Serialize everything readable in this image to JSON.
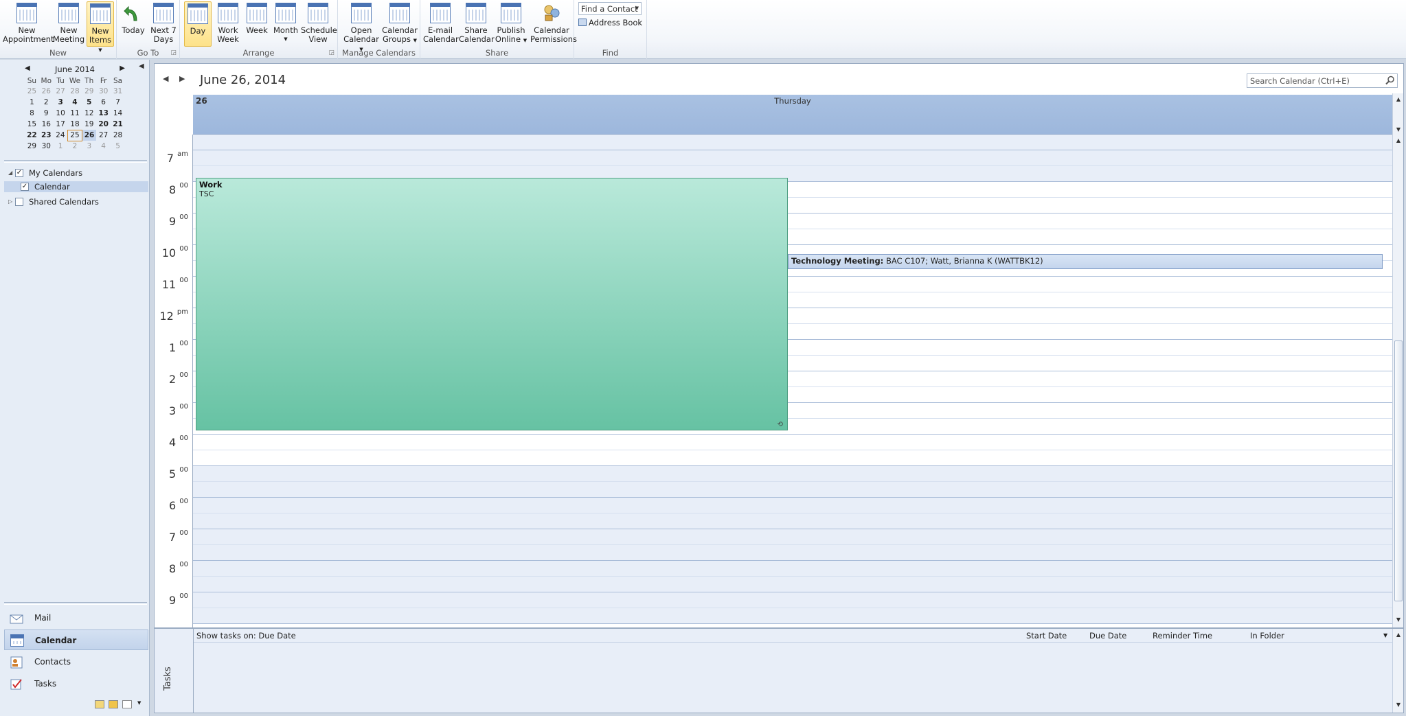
{
  "ribbon": {
    "groups": {
      "new": "New",
      "goto": "Go To",
      "arrange": "Arrange",
      "manage": "Manage Calendars",
      "share": "Share",
      "find": "Find"
    },
    "buttons": {
      "new_appointment": [
        "New",
        "Appointment"
      ],
      "new_meeting": [
        "New",
        "Meeting"
      ],
      "new_items": [
        "New",
        "Items"
      ],
      "today": [
        "Today",
        ""
      ],
      "next7": [
        "Next 7",
        "Days"
      ],
      "day": [
        "Day",
        ""
      ],
      "work_week": [
        "Work",
        "Week"
      ],
      "week": [
        "Week",
        ""
      ],
      "month": [
        "Month",
        ""
      ],
      "schedule": [
        "Schedule",
        "View"
      ],
      "open_calendar": [
        "Open",
        "Calendar"
      ],
      "calendar_groups": [
        "Calendar",
        "Groups"
      ],
      "email_calendar": [
        "E-mail",
        "Calendar"
      ],
      "share_calendar": [
        "Share",
        "Calendar"
      ],
      "publish_online": [
        "Publish",
        "Online"
      ],
      "permissions": [
        "Calendar",
        "Permissions"
      ]
    },
    "find_contact_placeholder": "Find a Contact",
    "address_book": "Address Book"
  },
  "mini_calendar": {
    "month_label": "June 2014",
    "weekdays": [
      "Su",
      "Mo",
      "Tu",
      "We",
      "Th",
      "Fr",
      "Sa"
    ],
    "weeks": [
      [
        "25",
        "26",
        "27",
        "28",
        "29",
        "30",
        "31"
      ],
      [
        "1",
        "2",
        "3",
        "4",
        "5",
        "6",
        "7"
      ],
      [
        "8",
        "9",
        "10",
        "11",
        "12",
        "13",
        "14"
      ],
      [
        "15",
        "16",
        "17",
        "18",
        "19",
        "20",
        "21"
      ],
      [
        "22",
        "23",
        "24",
        "25",
        "26",
        "27",
        "28"
      ],
      [
        "29",
        "30",
        "1",
        "2",
        "3",
        "4",
        "5"
      ]
    ]
  },
  "nav": {
    "my_calendars": "My Calendars",
    "calendar": "Calendar",
    "shared_calendars": "Shared Calendars",
    "mail": "Mail",
    "calendar_btn": "Calendar",
    "contacts": "Contacts",
    "tasks": "Tasks"
  },
  "calendar": {
    "date_title": "June 26, 2014",
    "search_placeholder": "Search Calendar (Ctrl+E)",
    "day_number": "26",
    "day_name": "Thursday",
    "hours": [
      {
        "h": "7",
        "s": "am"
      },
      {
        "h": "8",
        "s": "00"
      },
      {
        "h": "9",
        "s": "00"
      },
      {
        "h": "10",
        "s": "00"
      },
      {
        "h": "11",
        "s": "00"
      },
      {
        "h": "12",
        "s": "pm"
      },
      {
        "h": "1",
        "s": "00"
      },
      {
        "h": "2",
        "s": "00"
      },
      {
        "h": "3",
        "s": "00"
      },
      {
        "h": "4",
        "s": "00"
      },
      {
        "h": "5",
        "s": "00"
      },
      {
        "h": "6",
        "s": "00"
      },
      {
        "h": "7",
        "s": "00"
      },
      {
        "h": "8",
        "s": "00"
      },
      {
        "h": "9",
        "s": "00"
      }
    ],
    "appointments": {
      "work": {
        "title": "Work",
        "location": "TSC"
      },
      "meeting": {
        "title": "Technology Meeting:",
        "details": "BAC C107; Watt, Brianna K  (WATTBK12)"
      }
    }
  },
  "tasks": {
    "label": "Tasks",
    "show_on": "Show tasks on: Due Date",
    "columns": [
      "Start Date",
      "Due Date",
      "Reminder Time",
      "In Folder"
    ]
  }
}
